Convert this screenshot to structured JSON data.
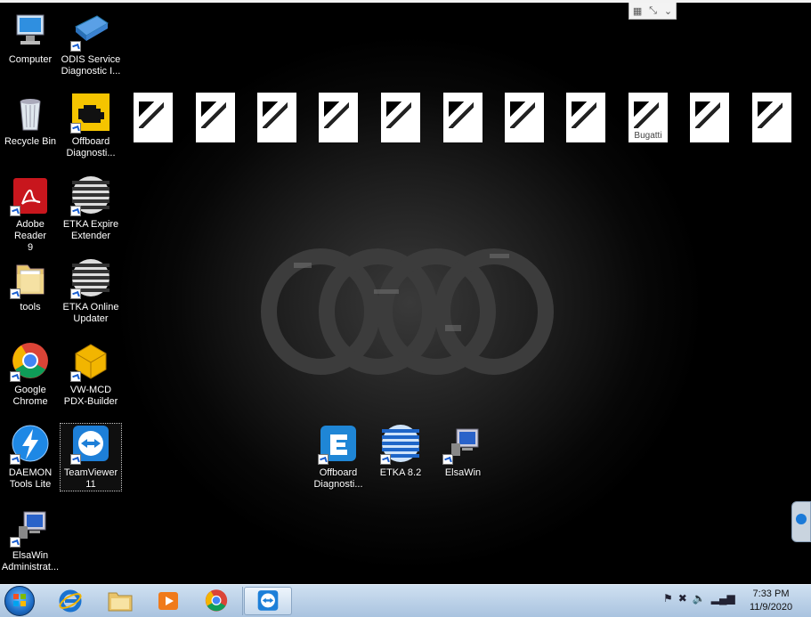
{
  "desktop": {
    "icons": [
      {
        "label": "Computer",
        "icon": "computer-icon"
      },
      {
        "label": "ODIS Service\nDiagnostic I...",
        "icon": "odis-icon"
      },
      {
        "label": "Recycle Bin",
        "icon": "recycle-bin-icon"
      },
      {
        "label": "Offboard\nDiagnosti...",
        "icon": "engine-check-icon"
      },
      {
        "label": "Adobe Reader\n9",
        "icon": "adobe-reader-icon"
      },
      {
        "label": "ETKA Expire\nExtender",
        "icon": "etka-icon"
      },
      {
        "label": "tools",
        "icon": "folder-icon"
      },
      {
        "label": "ETKA Online\nUpdater",
        "icon": "etka-icon"
      },
      {
        "label": "Google\nChrome",
        "icon": "chrome-icon"
      },
      {
        "label": "VW-MCD\nPDX-Builder",
        "icon": "package-icon"
      },
      {
        "label": "DAEMON\nTools Lite",
        "icon": "daemon-tools-icon"
      },
      {
        "label": "TeamViewer\n11",
        "icon": "teamviewer-icon"
      },
      {
        "label": "ElsaWin\nAdministrat...",
        "icon": "elsawin-icon"
      },
      {
        "label": "Offboard\nDiagnosti...",
        "icon": "offboard-e-icon"
      },
      {
        "label": "ETKA 8.2",
        "icon": "etka-icon"
      },
      {
        "label": "ElsaWin",
        "icon": "elsawin-icon"
      }
    ],
    "thumb_label": "Bugatti"
  },
  "remote_bar": {
    "icons": [
      "pin-icon",
      "restore-icon",
      "chevron-down-icon"
    ]
  },
  "taskbar": {
    "apps": [
      "start-button",
      "internet-explorer-icon",
      "explorer-folder-icon",
      "media-player-icon",
      "chrome-icon",
      "teamviewer-icon"
    ],
    "clock_time": "7:33 PM",
    "clock_date": "11/9/2020"
  },
  "colors": {
    "accent": "#1a7ad8",
    "taskbar": "#b8cfe6"
  }
}
